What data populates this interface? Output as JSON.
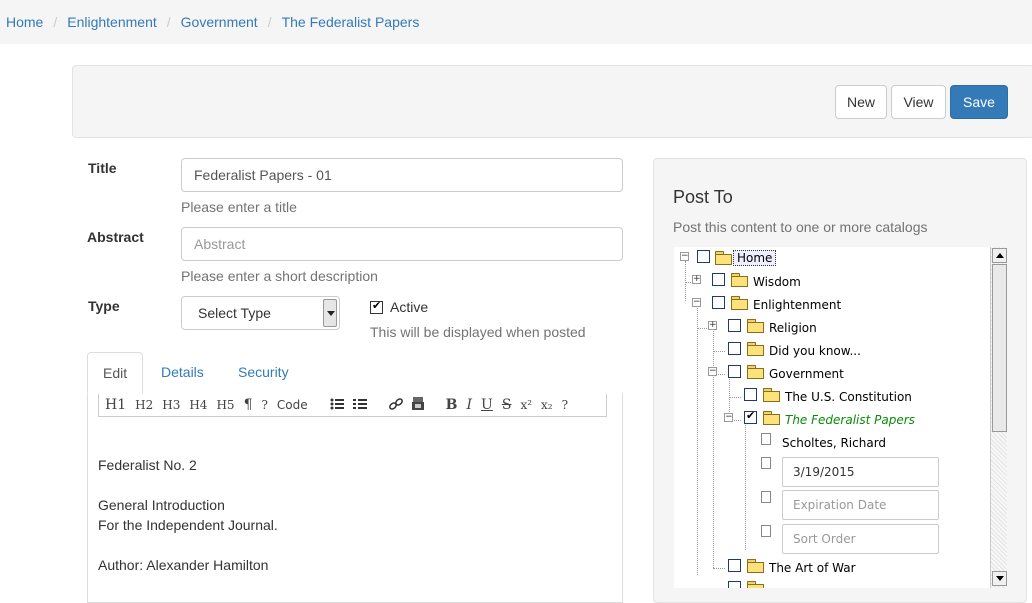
{
  "breadcrumb": [
    "Home",
    "Enlightenment",
    "Government",
    "The Federalist Papers"
  ],
  "toolbar": {
    "new_label": "New",
    "view_label": "View",
    "save_label": "Save"
  },
  "colors": {
    "primary": "#337ab7",
    "tree_selected": "#0a8a0a"
  },
  "form": {
    "title_label": "Title",
    "title_value": "Federalist Papers - 01",
    "title_help": "Please enter a title",
    "abstract_label": "Abstract",
    "abstract_placeholder": "Abstract",
    "abstract_help": "Please enter a short description",
    "type_label": "Type",
    "type_selected": "Select Type",
    "active_label": "Active",
    "active_checked": true,
    "active_help": "This will be displayed when posted"
  },
  "tabs": [
    "Edit",
    "Details",
    "Security"
  ],
  "editor": {
    "toolbar": [
      "H1",
      "H2",
      "H3",
      "H4",
      "H5",
      "¶",
      "?",
      "Code",
      "bullet-list-icon",
      "numbered-list-icon",
      "link-icon",
      "image-icon",
      "B",
      "I",
      "U",
      "S",
      "x²",
      "x₂",
      "?"
    ],
    "lines": [
      "Federalist No. 2",
      "General Introduction",
      "For the Independent Journal.",
      "Author: Alexander Hamilton"
    ]
  },
  "post_to": {
    "title": "Post To",
    "subtitle": "Post this content to one or more catalogs",
    "tree": {
      "home": "Home",
      "wisdom": "Wisdom",
      "enlightenment": "Enlightenment",
      "religion": "Religion",
      "did_you_know": "Did you know...",
      "government": "Government",
      "constitution": "The U.S. Constitution",
      "federalist": "The Federalist Papers",
      "author": "Scholtes, Richard",
      "date_value": "3/19/2015",
      "expiration_placeholder": "Expiration Date",
      "sort_placeholder": "Sort Order",
      "art_of_war": "The Art of War"
    }
  }
}
